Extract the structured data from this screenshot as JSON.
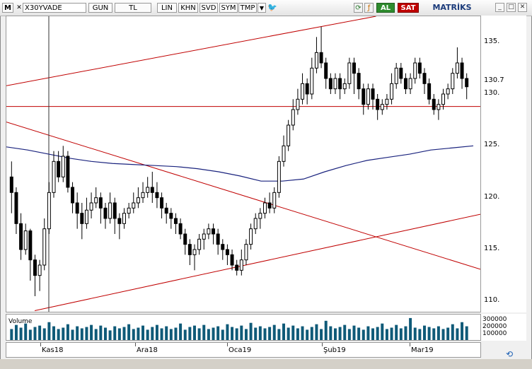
{
  "toolbar": {
    "menu_icon": "M",
    "symbol": "X30YVADE",
    "period": "GUN",
    "currency": "TL",
    "scale_lin": "LIN",
    "khn": "KHN",
    "svd": "SVD",
    "sym": "SYM",
    "tmp": "TMP",
    "buy_label": "AL",
    "sell_label": "SAT",
    "brand": "MATRİKS",
    "icons": [
      "menu-icon",
      "close-icon",
      "dropdown-icon",
      "twitter-icon",
      "refresh-icon",
      "formula-icon",
      "chart-icon",
      "minimize-icon",
      "maximize-icon",
      "close-window-icon"
    ]
  },
  "colors": {
    "trendline": "#c00000",
    "moving_average": "#1a237e",
    "candle_up": "#ffffff",
    "candle_down": "#000000",
    "volume": "#0f5a78",
    "buy": "#2e8b2e",
    "sell": "#c00000"
  },
  "volume_panel": {
    "title": "Volume",
    "axis_labels": [
      "300000",
      "200000",
      "100000"
    ]
  },
  "chart_data": {
    "type": "candlestick",
    "symbol": "X30YVADE",
    "y_ticks": [
      135.0,
      130.0,
      125.0,
      120.0,
      115.0,
      110.0
    ],
    "y_tick_labels": [
      "135.",
      "130.",
      "125.",
      "120.",
      "115.",
      "110."
    ],
    "ylim": [
      109.0,
      137.5
    ],
    "current_price_label": "130.7",
    "x_labels": [
      "Kas18",
      "Ara18",
      "Oca19",
      "Şub19",
      "Mar19"
    ],
    "moving_average": [
      124.9,
      124.6,
      124.2,
      123.8,
      123.5,
      123.3,
      123.2,
      123.1,
      123.0,
      122.8,
      122.5,
      122.1,
      121.6,
      121.6,
      121.8,
      122.5,
      123.1,
      123.6,
      123.9,
      124.2,
      124.6,
      124.8,
      125.0
    ],
    "candles": [
      [
        122.0,
        120.5,
        123.5,
        118.5
      ],
      [
        120.5,
        117.5,
        121.0,
        116.5
      ],
      [
        117.5,
        115.0,
        118.5,
        114.0
      ],
      [
        115.0,
        116.8,
        117.5,
        114.5
      ],
      [
        116.8,
        114.0,
        117.0,
        112.0
      ],
      [
        114.0,
        112.5,
        114.5,
        110.5
      ],
      [
        112.5,
        113.5,
        114.0,
        111.0
      ],
      [
        113.5,
        117.0,
        118.0,
        113.0
      ],
      [
        117.0,
        120.5,
        121.5,
        116.5
      ],
      [
        120.5,
        123.5,
        124.5,
        120.0
      ],
      [
        123.5,
        122.0,
        124.5,
        121.5
      ],
      [
        122.0,
        124.0,
        125.0,
        121.5
      ],
      [
        124.0,
        121.0,
        124.5,
        120.5
      ],
      [
        121.0,
        119.5,
        121.5,
        118.5
      ],
      [
        119.5,
        118.5,
        120.5,
        117.0
      ],
      [
        118.5,
        117.5,
        119.5,
        116.0
      ],
      [
        117.5,
        118.8,
        120.0,
        117.0
      ],
      [
        118.8,
        119.5,
        120.5,
        118.0
      ],
      [
        119.5,
        120.0,
        121.0,
        119.0
      ],
      [
        120.0,
        119.0,
        120.5,
        117.5
      ],
      [
        119.0,
        118.0,
        119.5,
        117.0
      ],
      [
        118.0,
        119.5,
        120.5,
        117.5
      ],
      [
        119.5,
        118.0,
        120.0,
        116.5
      ],
      [
        118.0,
        117.5,
        118.5,
        116.0
      ],
      [
        117.5,
        118.5,
        119.0,
        117.0
      ],
      [
        118.5,
        119.0,
        119.5,
        118.0
      ],
      [
        119.0,
        119.5,
        120.5,
        118.5
      ],
      [
        119.5,
        120.0,
        121.0,
        119.0
      ],
      [
        120.0,
        120.5,
        121.5,
        119.5
      ],
      [
        120.5,
        121.0,
        122.0,
        120.0
      ],
      [
        121.0,
        120.5,
        122.5,
        119.5
      ],
      [
        120.5,
        120.0,
        121.5,
        119.0
      ],
      [
        120.0,
        119.0,
        120.5,
        118.0
      ],
      [
        119.0,
        118.5,
        119.5,
        117.5
      ],
      [
        118.5,
        118.0,
        119.0,
        117.0
      ],
      [
        118.0,
        117.5,
        118.5,
        116.5
      ],
      [
        117.5,
        116.5,
        118.0,
        116.0
      ],
      [
        116.5,
        115.5,
        117.0,
        114.5
      ],
      [
        115.5,
        114.5,
        116.0,
        113.5
      ],
      [
        114.5,
        115.0,
        115.5,
        113.0
      ],
      [
        115.0,
        116.0,
        116.5,
        114.5
      ],
      [
        116.0,
        116.5,
        117.0,
        115.0
      ],
      [
        116.5,
        117.0,
        117.5,
        116.0
      ],
      [
        117.0,
        116.5,
        117.5,
        115.5
      ],
      [
        116.5,
        115.5,
        117.0,
        114.5
      ],
      [
        115.5,
        115.0,
        116.0,
        114.0
      ],
      [
        115.0,
        114.5,
        115.5,
        113.5
      ],
      [
        114.5,
        113.5,
        115.0,
        113.0
      ],
      [
        113.5,
        113.0,
        114.0,
        112.5
      ],
      [
        113.0,
        114.0,
        115.0,
        112.5
      ],
      [
        114.0,
        115.5,
        116.0,
        113.5
      ],
      [
        115.5,
        117.0,
        117.5,
        115.0
      ],
      [
        117.0,
        118.0,
        118.5,
        116.5
      ],
      [
        118.0,
        118.5,
        119.0,
        117.0
      ],
      [
        118.5,
        119.5,
        120.0,
        118.0
      ],
      [
        119.5,
        119.0,
        120.5,
        118.5
      ],
      [
        119.0,
        120.5,
        121.0,
        118.5
      ],
      [
        120.5,
        123.5,
        124.0,
        120.0
      ],
      [
        123.5,
        125.0,
        126.0,
        123.0
      ],
      [
        125.0,
        127.0,
        127.5,
        124.5
      ],
      [
        127.0,
        128.5,
        129.5,
        126.5
      ],
      [
        128.5,
        129.5,
        130.5,
        128.0
      ],
      [
        129.5,
        131.0,
        132.0,
        129.0
      ],
      [
        131.0,
        130.0,
        131.5,
        129.0
      ],
      [
        130.0,
        132.5,
        133.5,
        129.5
      ],
      [
        132.5,
        134.0,
        135.5,
        132.0
      ],
      [
        134.0,
        133.0,
        136.5,
        132.5
      ],
      [
        133.0,
        131.5,
        133.5,
        130.5
      ],
      [
        131.5,
        130.5,
        132.0,
        130.0
      ],
      [
        130.5,
        131.5,
        132.0,
        130.0
      ],
      [
        131.5,
        130.5,
        132.0,
        129.5
      ],
      [
        130.5,
        131.0,
        131.5,
        130.0
      ],
      [
        131.0,
        133.0,
        133.5,
        130.5
      ],
      [
        133.0,
        132.0,
        133.5,
        130.0
      ],
      [
        132.0,
        130.5,
        132.5,
        129.5
      ],
      [
        130.5,
        129.0,
        131.0,
        128.0
      ],
      [
        129.0,
        130.5,
        131.0,
        128.5
      ],
      [
        130.5,
        129.5,
        131.0,
        128.5
      ],
      [
        129.5,
        128.5,
        130.0,
        127.5
      ],
      [
        128.5,
        129.0,
        129.5,
        128.0
      ],
      [
        129.0,
        129.5,
        130.0,
        128.5
      ],
      [
        129.5,
        131.0,
        132.0,
        129.0
      ],
      [
        131.0,
        132.5,
        133.0,
        130.5
      ],
      [
        132.5,
        131.5,
        133.0,
        131.0
      ],
      [
        131.5,
        130.5,
        132.0,
        130.0
      ],
      [
        130.5,
        131.5,
        132.0,
        130.0
      ],
      [
        131.5,
        133.0,
        133.5,
        131.0
      ],
      [
        133.0,
        132.0,
        133.5,
        131.5
      ],
      [
        132.0,
        131.0,
        132.5,
        130.0
      ],
      [
        131.0,
        129.5,
        131.5,
        129.0
      ],
      [
        129.5,
        128.5,
        130.0,
        128.0
      ],
      [
        128.5,
        129.0,
        129.5,
        127.5
      ],
      [
        129.0,
        130.0,
        130.5,
        128.5
      ],
      [
        130.0,
        130.5,
        131.0,
        129.5
      ],
      [
        130.5,
        132.0,
        132.5,
        130.0
      ],
      [
        132.0,
        133.0,
        134.5,
        131.5
      ],
      [
        133.0,
        131.5,
        133.5,
        130.5
      ],
      [
        131.5,
        130.7,
        132.0,
        129.5
      ]
    ],
    "volumes": [
      1.6,
      2.2,
      1.8,
      2.4,
      1.5,
      1.9,
      2.1,
      1.7,
      2.6,
      2.0,
      1.6,
      1.8,
      2.3,
      1.5,
      2.0,
      1.7,
      1.9,
      2.2,
      1.6,
      2.1,
      1.8,
      1.4,
      2.0,
      1.7,
      1.9,
      2.3,
      1.6,
      1.8,
      2.1,
      1.5,
      1.9,
      2.2,
      1.7,
      2.0,
      1.6,
      1.8,
      2.4,
      1.5,
      1.9,
      2.1,
      1.7,
      2.2,
      1.6,
      1.8,
      2.0,
      1.5,
      2.3,
      1.9,
      1.7,
      2.1,
      1.6,
      2.5,
      1.8,
      2.0,
      1.7,
      1.9,
      2.2,
      1.6,
      2.4,
      1.8,
      2.1,
      1.7,
      2.0,
      1.5,
      1.9,
      2.3,
      1.6,
      2.8,
      2.0,
      1.7,
      1.9,
      2.2,
      1.6,
      2.1,
      1.8,
      1.5,
      2.0,
      1.7,
      1.9,
      2.4,
      1.6,
      1.8,
      2.2,
      1.7,
      2.0,
      3.2,
      1.8,
      1.6,
      2.1,
      1.9,
      1.7,
      2.0,
      1.6,
      1.8,
      2.3,
      1.7,
      2.6,
      2.0
    ]
  }
}
